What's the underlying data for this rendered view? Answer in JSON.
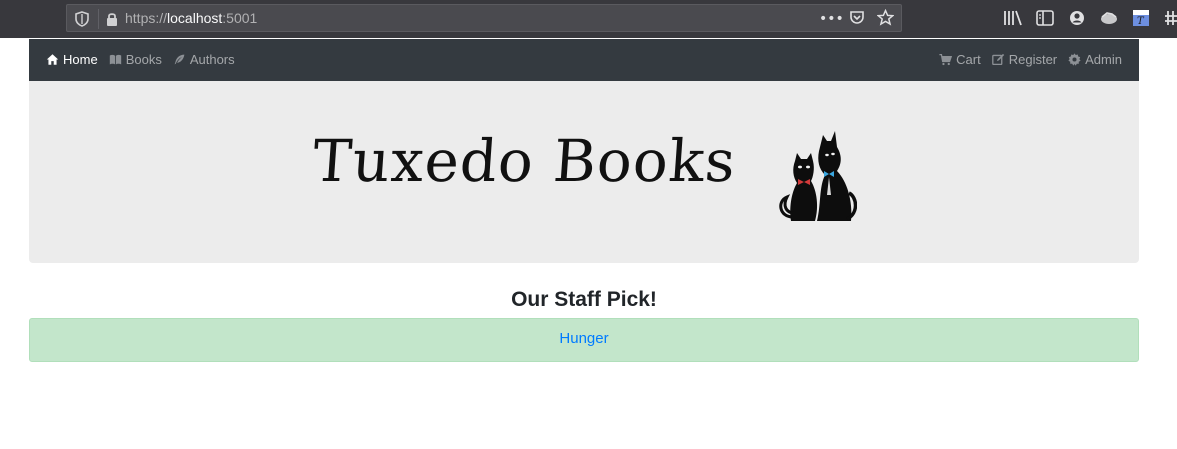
{
  "browser": {
    "url_scheme": "https://",
    "url_host": "localhost",
    "url_port": ":5001"
  },
  "navbar": {
    "left_items": [
      {
        "label": "Home",
        "icon": "home-icon",
        "active": true
      },
      {
        "label": "Books",
        "icon": "book-icon",
        "active": false
      },
      {
        "label": "Authors",
        "icon": "feather-icon",
        "active": false
      }
    ],
    "right_items": [
      {
        "label": "Cart",
        "icon": "cart-icon"
      },
      {
        "label": "Register",
        "icon": "edit-icon"
      },
      {
        "label": "Admin",
        "icon": "gear-icon"
      }
    ]
  },
  "banner": {
    "logo_text": "Tuxedo Books"
  },
  "staff_pick": {
    "heading": "Our Staff Pick!",
    "book_title": "Hunger"
  },
  "colors": {
    "navbar_bg": "#343a40",
    "jumbotron_bg": "#ececec",
    "pick_bg": "#c3e6cb",
    "link": "#007bff"
  }
}
